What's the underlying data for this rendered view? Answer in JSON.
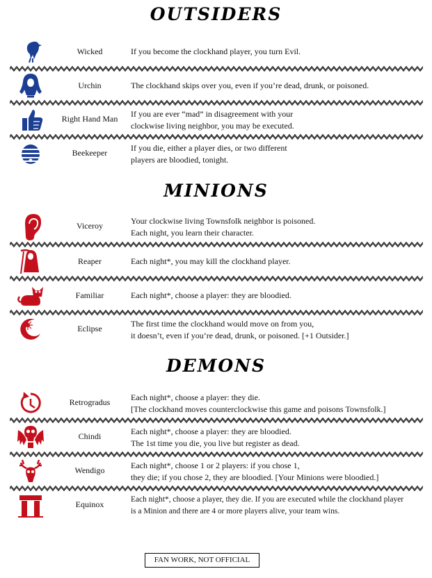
{
  "sections": {
    "outsiders": "OUTSIDERS",
    "minions": "MINIONS",
    "demons": "DEMONS"
  },
  "colors": {
    "good": "#1c3f94",
    "evil": "#c4101c"
  },
  "outsiders": [
    {
      "name": "Wicked",
      "icon": "raven-icon",
      "lines": [
        "If you become the clockhand player, you turn Evil."
      ]
    },
    {
      "name": "Urchin",
      "icon": "hooded-child-icon",
      "lines": [
        "The clockhand skips over you, even if you’re dead, drunk, or poisoned."
      ]
    },
    {
      "name": "Right Hand Man",
      "icon": "thumbs-up-icon",
      "lines": [
        "If you are ever “mad” in disagreement with your",
        "clockwise living neighbor, you may be executed."
      ]
    },
    {
      "name": "Beekeeper",
      "icon": "beehive-icon",
      "lines": [
        "If you die, either a player dies, or two different",
        "players are bloodied, tonight."
      ]
    }
  ],
  "minions": [
    {
      "name": "Viceroy",
      "icon": "ear-icon",
      "lines": [
        "Your clockwise living Townsfolk neighbor is poisoned.",
        "Each night, you learn their character."
      ]
    },
    {
      "name": "Reaper",
      "icon": "grim-reaper-icon",
      "lines": [
        "Each night*, you may kill the clockhand player."
      ]
    },
    {
      "name": "Familiar",
      "icon": "cat-icon",
      "lines": [
        "Each night*, choose a player: they are bloodied."
      ]
    },
    {
      "name": "Eclipse",
      "icon": "eclipse-icon",
      "lines": [
        "The first time the clockhand would move on from you,",
        "it doesn’t, even if you’re dead, drunk, or poisoned. [+1 Outsider.]"
      ]
    }
  ],
  "demons": [
    {
      "name": "Retrogradus",
      "icon": "counterclockwise-icon",
      "lines": [
        "Each night*, choose a player: they die.",
        "[The clockhand moves counterclockwise this game and poisons Townsfolk.]"
      ]
    },
    {
      "name": "Chindi",
      "icon": "winged-skull-icon",
      "lines": [
        "Each night*, choose a player: they are bloodied.",
        "The 1st time you die, you live but register as dead."
      ]
    },
    {
      "name": "Wendigo",
      "icon": "antlered-skull-icon",
      "lines": [
        "Each night*, choose 1 or 2 players: if you chose 1,",
        "they die; if you chose 2, they are bloodied. [Your Minions were bloodied.]"
      ]
    },
    {
      "name": "Equinox",
      "icon": "stone-arch-icon",
      "small": true,
      "lines": [
        "Each night*, choose a player, they die. If you are executed while the clockhand player",
        "is a Minion and there are 4 or more players alive, your team wins."
      ]
    }
  ],
  "footer": "FAN WORK, NOT OFFICIAL"
}
